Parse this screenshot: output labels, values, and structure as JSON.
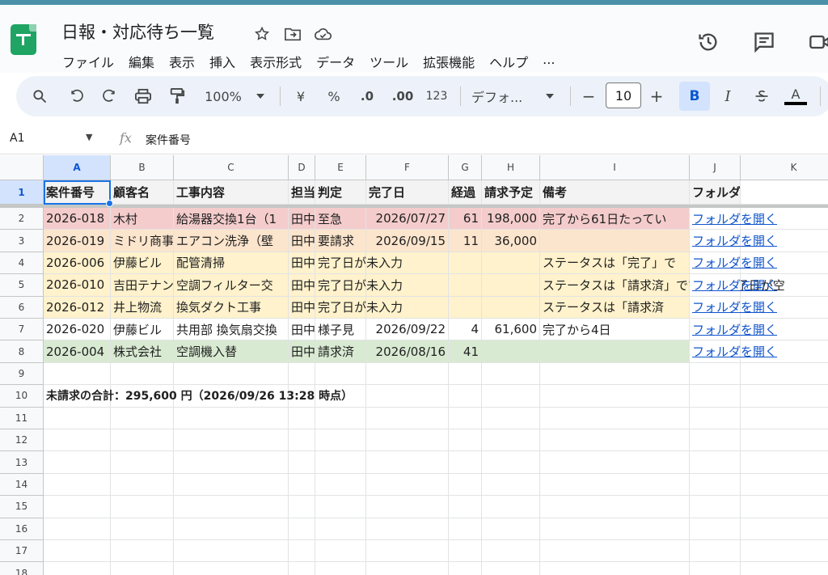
{
  "app": {
    "doc_title": "日報・対応待ち一覧",
    "menu": [
      "ファイル",
      "編集",
      "表示",
      "挿入",
      "表示形式",
      "データ",
      "ツール",
      "拡張機能",
      "ヘルプ",
      "..."
    ]
  },
  "toolbar": {
    "zoom": "100%",
    "currency": "¥",
    "percent": "%",
    "dec_decrease": ".0",
    "dec_increase": ".00",
    "number_format": "123",
    "font": "デフォ...",
    "font_size": "10",
    "minus": "−",
    "plus": "+",
    "bold": "B",
    "italic": "I",
    "text_color": "A"
  },
  "formula_bar": {
    "cell_ref": "A1",
    "fx": "fx",
    "content": "案件番号"
  },
  "columns": [
    "A",
    "B",
    "C",
    "D",
    "E",
    "F",
    "G",
    "H",
    "I",
    "J",
    "K"
  ],
  "row_numbers": [
    "1",
    "2",
    "3",
    "4",
    "5",
    "6",
    "7",
    "8",
    "9",
    "10",
    "11",
    "12",
    "13",
    "14",
    "15",
    "16",
    "17",
    "18"
  ],
  "headers": [
    "案件番号",
    "顧客名",
    "工事内容",
    "担当",
    "判定",
    "完了日",
    "経過",
    "請求予定",
    "備考",
    "フォルダ"
  ],
  "rows": [
    {
      "id": "2026-018",
      "customer": "木村",
      "work": "給湯器交換1台（1",
      "staff": "田中",
      "status": "至急",
      "done": "2026/07/27",
      "days": "61",
      "amount": "198,000",
      "note": "完了から61日たってい",
      "folder": "フォルダを開く",
      "color": "red"
    },
    {
      "id": "2026-019",
      "customer": "ミドリ商事",
      "work": "エアコン洗浄（壁",
      "staff": "田中",
      "status": "要請求",
      "done": "2026/09/15",
      "days": "11",
      "amount": "36,000",
      "note": "",
      "folder": "フォルダを開く",
      "color": "orange"
    },
    {
      "id": "2026-006",
      "customer": "伊藤ビル",
      "work": "配管清掃",
      "staff": "田中",
      "status": "完了日が未入力",
      "done": "",
      "days": "",
      "amount": "",
      "note": "ステータスは「完了」で",
      "folder": "フォルダを開く",
      "color": "yellow"
    },
    {
      "id": "2026-010",
      "customer": "吉田テナント",
      "work": "空調フィルター交",
      "staff": "田中",
      "status": "完了日が未入力",
      "done": "",
      "days": "",
      "amount": "",
      "note": "ステータスは「請求済」ですが、完了日が空",
      "folder": "フォルダを開く",
      "color": "yellow"
    },
    {
      "id": "2026-012",
      "customer": "井上物流",
      "work": "換気ダクト工事",
      "staff": "田中",
      "status": "完了日が未入力",
      "done": "",
      "days": "",
      "amount": "",
      "note": "ステータスは「請求済",
      "folder": "フォルダを開く",
      "color": "yellow"
    },
    {
      "id": "2026-020",
      "customer": "伊藤ビル",
      "work": "共用部 換気扇交換",
      "staff": "田中",
      "status": "様子見",
      "done": "2026/09/22",
      "days": "4",
      "amount": "61,600",
      "note": "完了から4日",
      "folder": "フォルダを開く",
      "color": "white"
    },
    {
      "id": "2026-004",
      "customer": "株式会社",
      "work": "空調機入替",
      "staff": "田中",
      "status": "請求済",
      "done": "2026/08/16",
      "days": "41",
      "amount": "",
      "note": "",
      "folder": "フォルダを開く",
      "color": "green"
    }
  ],
  "summary": "未請求の合計：295,600 円（2026/09/26 13:28 時点）"
}
